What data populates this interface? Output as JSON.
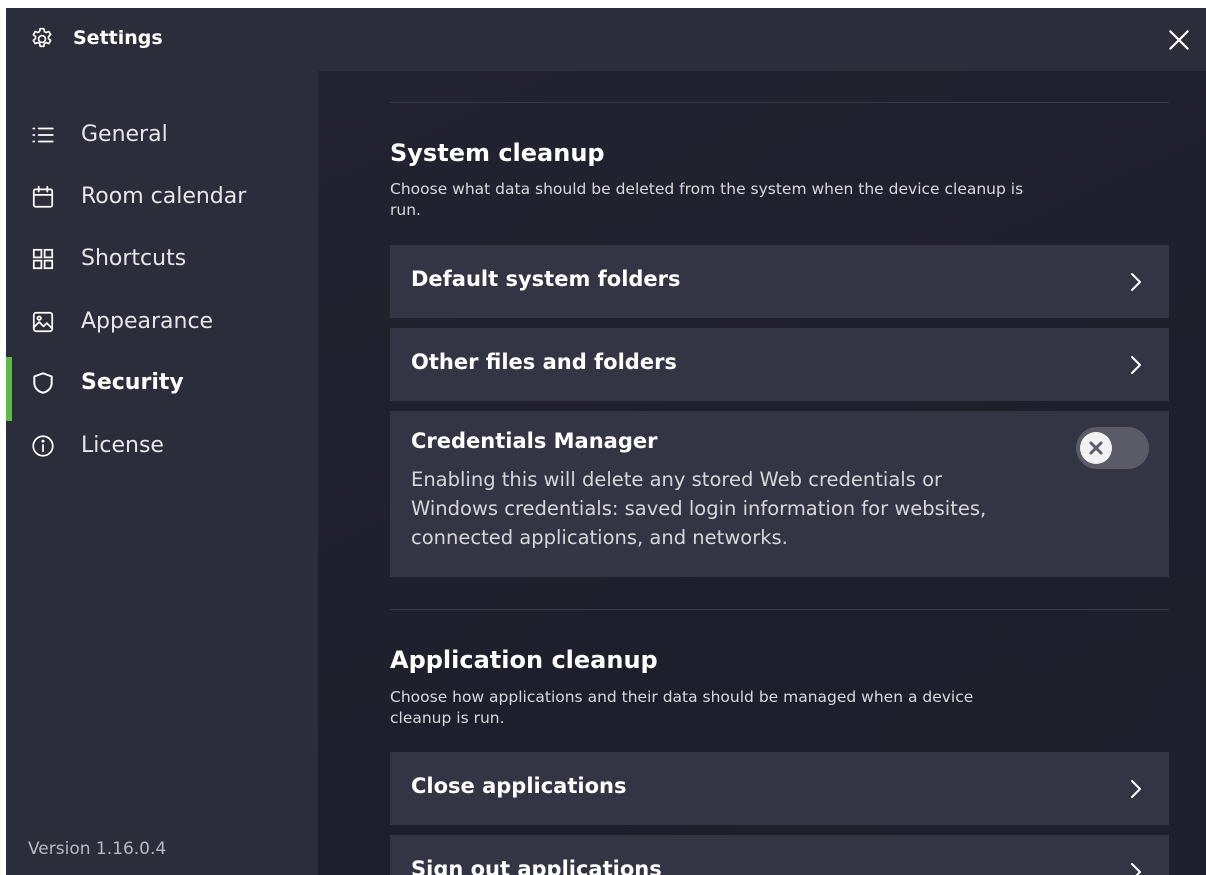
{
  "window": {
    "title": "Settings"
  },
  "icons": {
    "title": "gear-icon",
    "close": "close-icon",
    "chevron": "chevron-right-icon",
    "toggle_knob": "x-icon"
  },
  "sidebar": {
    "items": [
      {
        "label": "General",
        "icon": "list-icon",
        "active": false
      },
      {
        "label": "Room calendar",
        "icon": "calendar-icon",
        "active": false
      },
      {
        "label": "Shortcuts",
        "icon": "grid-icon",
        "active": false
      },
      {
        "label": "Appearance",
        "icon": "image-icon",
        "active": false
      },
      {
        "label": "Security",
        "icon": "shield-icon",
        "active": true
      },
      {
        "label": "License",
        "icon": "info-icon",
        "active": false
      }
    ],
    "version": "Version 1.16.0.4"
  },
  "colors": {
    "accent": "#5fb84a",
    "window_bg": "#1e1f2b",
    "sidebar_bg": "#2c2d3a",
    "card_bg": "#343544"
  },
  "system_cleanup": {
    "title": "System cleanup",
    "description": "Choose what data should be deleted from the system when the device cleanup is run.",
    "cards": [
      {
        "label": "Default system folders"
      },
      {
        "label": "Other files and folders"
      }
    ],
    "credentials": {
      "title": "Credentials Manager",
      "description": "Enabling this will delete any stored Web credentials or Windows credentials: saved login information for websites, connected applications, and networks.",
      "enabled": false
    }
  },
  "application_cleanup": {
    "title": "Application cleanup",
    "description": "Choose how applications and their data should be managed when a device cleanup is run.",
    "cards": [
      {
        "label": "Close applications"
      },
      {
        "label": "Sign out applications"
      }
    ]
  }
}
